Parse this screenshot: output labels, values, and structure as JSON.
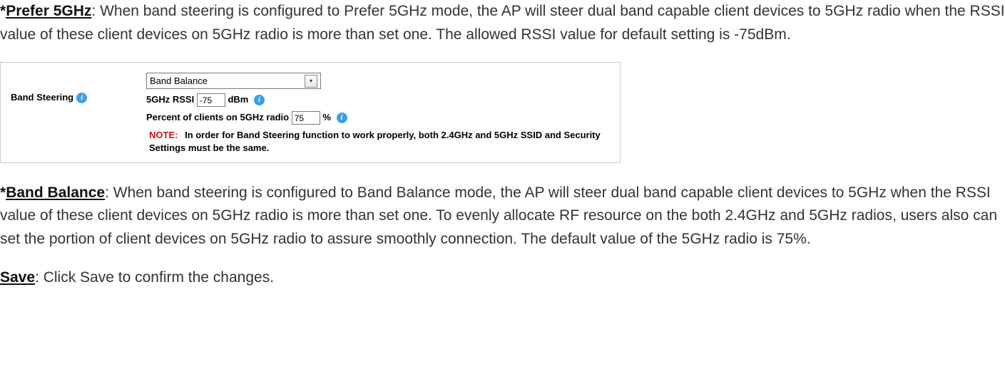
{
  "para1": {
    "heading": "Prefer 5GHz",
    "body": ": When band steering is configured to Prefer 5GHz mode, the AP will steer dual band capable client devices to 5GHz radio when the RSSI value of these client devices on 5GHz radio is more than set one. The allowed RSSI value for default setting is -75dBm."
  },
  "ui": {
    "left_label": "Band Steering",
    "select_value": "Band Balance",
    "rssi_label": "5GHz RSSI",
    "rssi_value": "-75",
    "rssi_unit": "dBm",
    "percent_label": "Percent of clients on 5GHz radio",
    "percent_value": "75",
    "percent_unit": "%",
    "note_label": "NOTE:",
    "note_text": "In order for Band Steering function to work properly, both 2.4GHz and 5GHz SSID and Security Settings must be the same."
  },
  "para2": {
    "heading": "Band Balance",
    "body": ": When band steering is configured to Band Balance mode, the AP will steer dual band capable client devices to 5GHz when the RSSI value of these client devices on 5GHz radio is more than set one. To evenly allocate RF resource on the both 2.4GHz and 5GHz radios, users also can set the portion of client devices on 5GHz radio to assure smoothly connection. The default value of the 5GHz radio is 75%."
  },
  "para3": {
    "heading": "Save",
    "body": ": Click Save to confirm the changes."
  }
}
